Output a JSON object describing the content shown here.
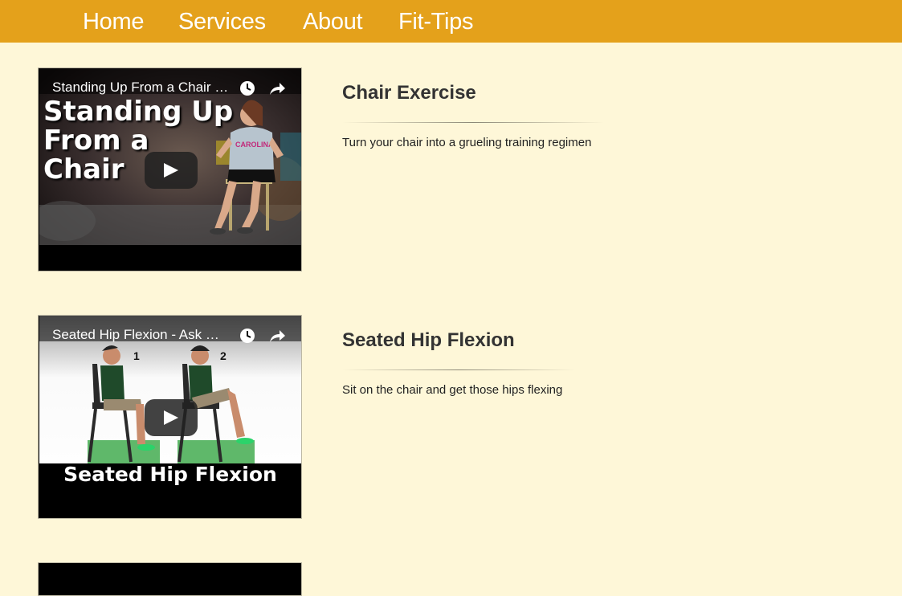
{
  "nav": {
    "home": "Home",
    "services": "Services",
    "about": "About",
    "fit_tips": "Fit-Tips"
  },
  "videos": [
    {
      "player_title": "Standing Up From a Chair Exercise",
      "thumbnail_text": [
        "Standing Up",
        "From a",
        "Chair"
      ],
      "shirt_text": "CAROLINA",
      "heading": "Chair Exercise",
      "description": "Turn your chair into a grueling training regimen"
    },
    {
      "player_title": "Seated Hip Flexion - Ask Doctor Jo",
      "thumbnail_text": "Seated Hip Flexion",
      "step_labels": [
        "1",
        "2"
      ],
      "heading": "Seated Hip Flexion",
      "description": "Sit on the chair and get those hips flexing"
    }
  ],
  "player_icons": [
    "clock-icon",
    "share-icon",
    "play-icon"
  ],
  "colors": {
    "nav_bg": "#e4a11b",
    "page_bg": "#fef7d8",
    "heading": "#333333",
    "video_bg": "#000000"
  }
}
